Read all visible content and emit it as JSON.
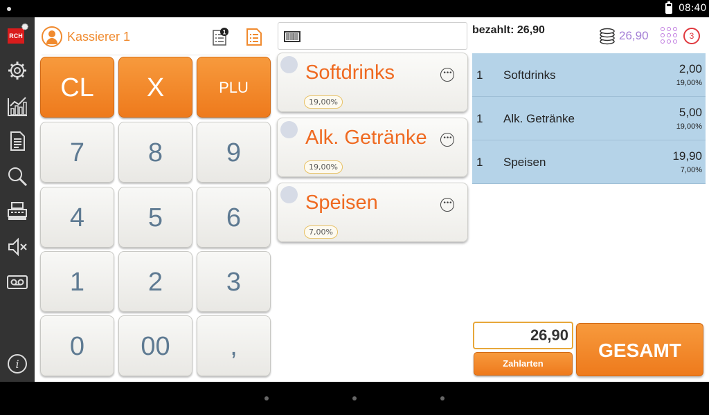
{
  "status_bar": {
    "time": "08:40"
  },
  "sidebar": {
    "logo_text": "RCH",
    "items": [
      {
        "icon": "gear-icon"
      },
      {
        "icon": "chart-icon"
      },
      {
        "icon": "document-icon"
      },
      {
        "icon": "search-icon"
      },
      {
        "icon": "cash-register-icon"
      },
      {
        "icon": "speaker-mute-icon"
      },
      {
        "icon": "voicemail-icon"
      },
      {
        "icon": "info-icon"
      }
    ]
  },
  "header": {
    "cashier": "Kassierer 1",
    "list_badge": "1"
  },
  "keypad": {
    "row1": [
      "CL",
      "X",
      "PLU"
    ],
    "row2": [
      "7",
      "8",
      "9"
    ],
    "row3": [
      "4",
      "5",
      "6"
    ],
    "row4": [
      "1",
      "2",
      "3"
    ],
    "row5": [
      "0",
      "00",
      ","
    ]
  },
  "categories": [
    {
      "name": "Softdrinks",
      "tax": "19,00%"
    },
    {
      "name": "Alk. Getränke",
      "tax": "19,00%"
    },
    {
      "name": "Speisen",
      "tax": "7,00%"
    }
  ],
  "summary": {
    "paid_label": "bezahlt: 26,90",
    "coin_total": "26,90",
    "badge_count": "3"
  },
  "receipt": [
    {
      "qty": "1",
      "item": "Softdrinks",
      "price": "2,00",
      "rate": "19,00%"
    },
    {
      "qty": "1",
      "item": "Alk. Getränke",
      "price": "5,00",
      "rate": "19,00%"
    },
    {
      "qty": "1",
      "item": "Speisen",
      "price": "19,90",
      "rate": "7,00%"
    }
  ],
  "footer": {
    "total": "26,90",
    "pay_methods_label": "Zahlarten",
    "total_button_label": "GESAMT"
  },
  "colors": {
    "accent_orange": "#EE7A1C",
    "receipt_row_bg": "#B5D3E8",
    "sidebar_bg": "#333333"
  }
}
